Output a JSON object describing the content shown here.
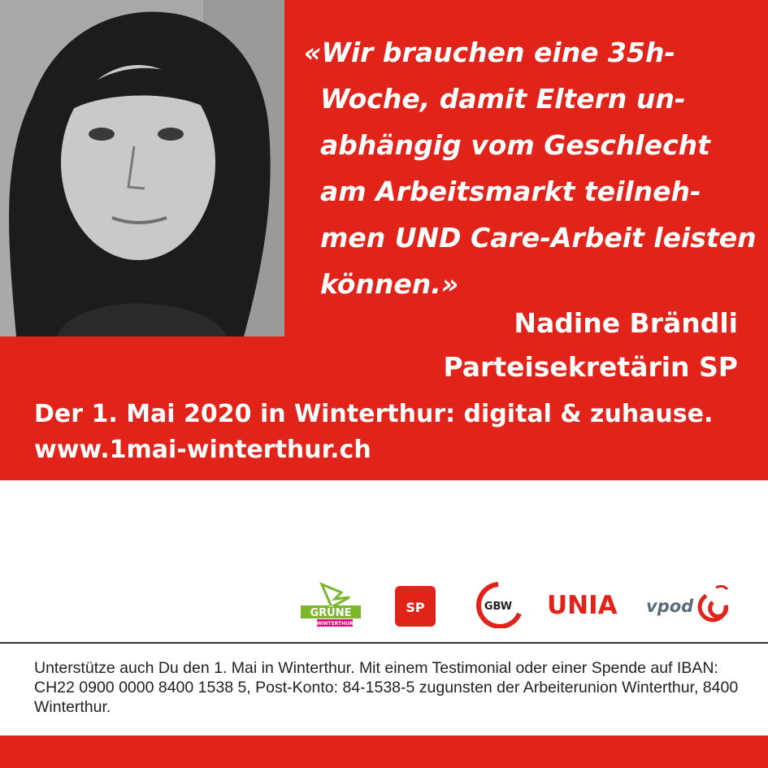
{
  "quote": {
    "text": "«Wir brauchen eine 35h-Woche, damit Eltern un-abhängig vom Geschlecht am Arbeitsmarkt teilneh-men UND Care-Arbeit leisten können.»"
  },
  "author": {
    "name": "Nadine Brändli",
    "role": "Parteisekretärin SP"
  },
  "event": {
    "line": "Der 1. Mai 2020 in Winterthur: digital & zuhause.",
    "url": "www.1mai-winterthur.ch"
  },
  "logos": {
    "gruene_label": "GRÜNE",
    "gruene_sub": "WINTERTHUR",
    "sp_label": "SP",
    "gbw_label": "GBW",
    "unia_label": "UNIA",
    "vpod_label": "vpod"
  },
  "footer": {
    "text": "Unterstütze auch Du den 1. Mai in Winterthur. Mit einem Testimonial oder einer Spende auf IBAN: CH22 0900 0000 8400 1538 5, Post-Konto: 84-1538-5 zugunsten der Arbeiterunion Winterthur, 8400 Winterthur."
  },
  "colors": {
    "brand_red": "#e2231a",
    "gruene_green": "#7ab829",
    "gruene_pink": "#e5007d",
    "vpod_grey": "#5a6b7a"
  }
}
